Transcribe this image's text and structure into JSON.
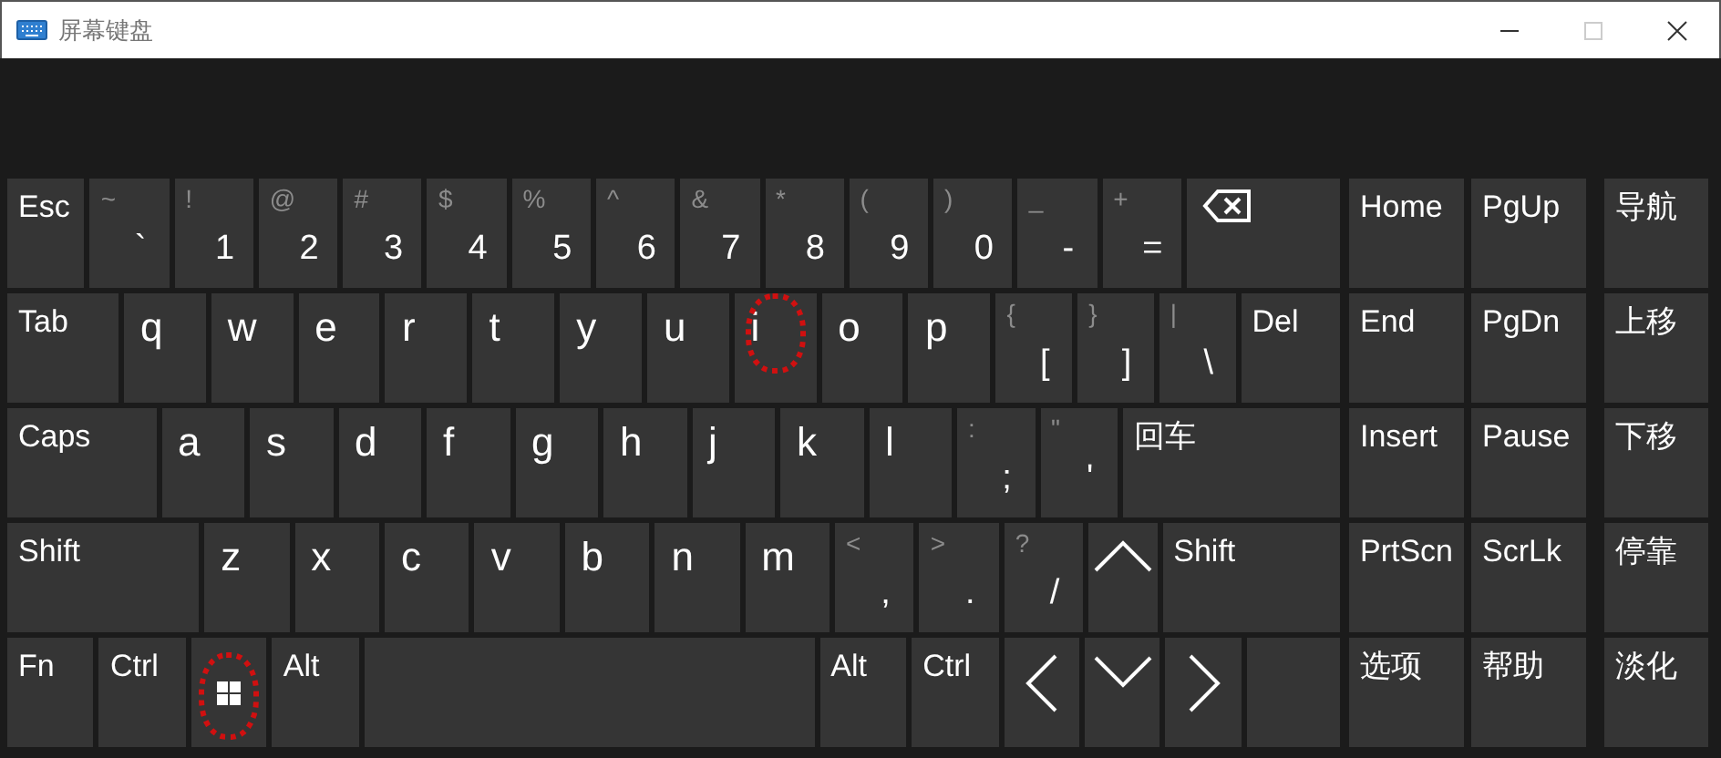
{
  "window": {
    "title": "屏幕键盘"
  },
  "main_rows": [
    [
      {
        "kind": "function",
        "label": "Esc",
        "highlighted": false
      },
      {
        "kind": "dual",
        "shift": "~",
        "label": "`",
        "highlighted": false
      },
      {
        "kind": "dual",
        "shift": "!",
        "label": "1",
        "highlighted": false
      },
      {
        "kind": "dual",
        "shift": "@",
        "label": "2",
        "highlighted": false
      },
      {
        "kind": "dual",
        "shift": "#",
        "label": "3",
        "highlighted": false
      },
      {
        "kind": "dual",
        "shift": "$",
        "label": "4",
        "highlighted": false
      },
      {
        "kind": "dual",
        "shift": "%",
        "label": "5",
        "highlighted": false
      },
      {
        "kind": "dual",
        "shift": "^",
        "label": "6",
        "highlighted": false
      },
      {
        "kind": "dual",
        "shift": "&",
        "label": "7",
        "highlighted": false
      },
      {
        "kind": "dual",
        "shift": "*",
        "label": "8",
        "highlighted": false
      },
      {
        "kind": "dual",
        "shift": "(",
        "label": "9",
        "highlighted": false
      },
      {
        "kind": "dual",
        "shift": ")",
        "label": "0",
        "highlighted": false
      },
      {
        "kind": "dual",
        "shift": "_",
        "label": "-",
        "highlighted": false
      },
      {
        "kind": "dual",
        "shift": "+",
        "label": "=",
        "highlighted": false
      },
      {
        "kind": "backspace",
        "highlighted": false
      }
    ],
    [
      {
        "kind": "function",
        "label": "Tab",
        "highlighted": false
      },
      {
        "kind": "letter",
        "label": "q",
        "highlighted": false
      },
      {
        "kind": "letter",
        "label": "w",
        "highlighted": false
      },
      {
        "kind": "letter",
        "label": "e",
        "highlighted": false
      },
      {
        "kind": "letter",
        "label": "r",
        "highlighted": false
      },
      {
        "kind": "letter",
        "label": "t",
        "highlighted": false
      },
      {
        "kind": "letter",
        "label": "y",
        "highlighted": false
      },
      {
        "kind": "letter",
        "label": "u",
        "highlighted": false
      },
      {
        "kind": "letter",
        "label": "i",
        "highlighted": true
      },
      {
        "kind": "letter",
        "label": "o",
        "highlighted": false
      },
      {
        "kind": "letter",
        "label": "p",
        "highlighted": false
      },
      {
        "kind": "dual",
        "shift": "{",
        "label": "[",
        "highlighted": false
      },
      {
        "kind": "dual",
        "shift": "}",
        "label": "]",
        "highlighted": false
      },
      {
        "kind": "dual",
        "shift": "|",
        "label": "\\",
        "highlighted": false
      },
      {
        "kind": "function",
        "label": "Del",
        "highlighted": false
      }
    ],
    [
      {
        "kind": "function",
        "label": "Caps",
        "highlighted": false
      },
      {
        "kind": "letter",
        "label": "a",
        "highlighted": false
      },
      {
        "kind": "letter",
        "label": "s",
        "highlighted": false
      },
      {
        "kind": "letter",
        "label": "d",
        "highlighted": false
      },
      {
        "kind": "letter",
        "label": "f",
        "highlighted": false
      },
      {
        "kind": "letter",
        "label": "g",
        "highlighted": false
      },
      {
        "kind": "letter",
        "label": "h",
        "highlighted": false
      },
      {
        "kind": "letter",
        "label": "j",
        "highlighted": false
      },
      {
        "kind": "letter",
        "label": "k",
        "highlighted": false
      },
      {
        "kind": "letter",
        "label": "l",
        "highlighted": false
      },
      {
        "kind": "dual",
        "shift": ":",
        "label": ";",
        "highlighted": false
      },
      {
        "kind": "dual",
        "shift": "\"",
        "label": "'",
        "highlighted": false
      },
      {
        "kind": "function",
        "label": "回车",
        "highlighted": false
      }
    ],
    [
      {
        "kind": "function",
        "label": "Shift",
        "highlighted": false
      },
      {
        "kind": "letter",
        "label": "z",
        "highlighted": false
      },
      {
        "kind": "letter",
        "label": "x",
        "highlighted": false
      },
      {
        "kind": "letter",
        "label": "c",
        "highlighted": false
      },
      {
        "kind": "letter",
        "label": "v",
        "highlighted": false
      },
      {
        "kind": "letter",
        "label": "b",
        "highlighted": false
      },
      {
        "kind": "letter",
        "label": "n",
        "highlighted": false
      },
      {
        "kind": "letter",
        "label": "m",
        "highlighted": false
      },
      {
        "kind": "dual",
        "shift": "<",
        "label": ",",
        "highlighted": false
      },
      {
        "kind": "dual",
        "shift": ">",
        "label": ".",
        "highlighted": false
      },
      {
        "kind": "dual",
        "shift": "?",
        "label": "/",
        "highlighted": false
      },
      {
        "kind": "up",
        "highlighted": false
      },
      {
        "kind": "function",
        "label": "Shift",
        "highlighted": false
      }
    ],
    [
      {
        "kind": "function",
        "label": "Fn",
        "highlighted": false
      },
      {
        "kind": "function",
        "label": "Ctrl",
        "highlighted": false
      },
      {
        "kind": "windows",
        "highlighted": true
      },
      {
        "kind": "function",
        "label": "Alt",
        "highlighted": false
      },
      {
        "kind": "space",
        "highlighted": false
      },
      {
        "kind": "function",
        "label": "Alt",
        "highlighted": false
      },
      {
        "kind": "function",
        "label": "Ctrl",
        "highlighted": false
      },
      {
        "kind": "left",
        "highlighted": false
      },
      {
        "kind": "down",
        "highlighted": false
      },
      {
        "kind": "right",
        "highlighted": false
      },
      {
        "kind": "blank",
        "highlighted": false
      }
    ]
  ],
  "nav_rows": [
    [
      "Home",
      "PgUp",
      "导航"
    ],
    [
      "End",
      "PgDn",
      "上移"
    ],
    [
      "Insert",
      "Pause",
      "下移"
    ],
    [
      "PrtScn",
      "ScrLk",
      "停靠"
    ],
    [
      "选项",
      "帮助",
      "淡化"
    ]
  ]
}
